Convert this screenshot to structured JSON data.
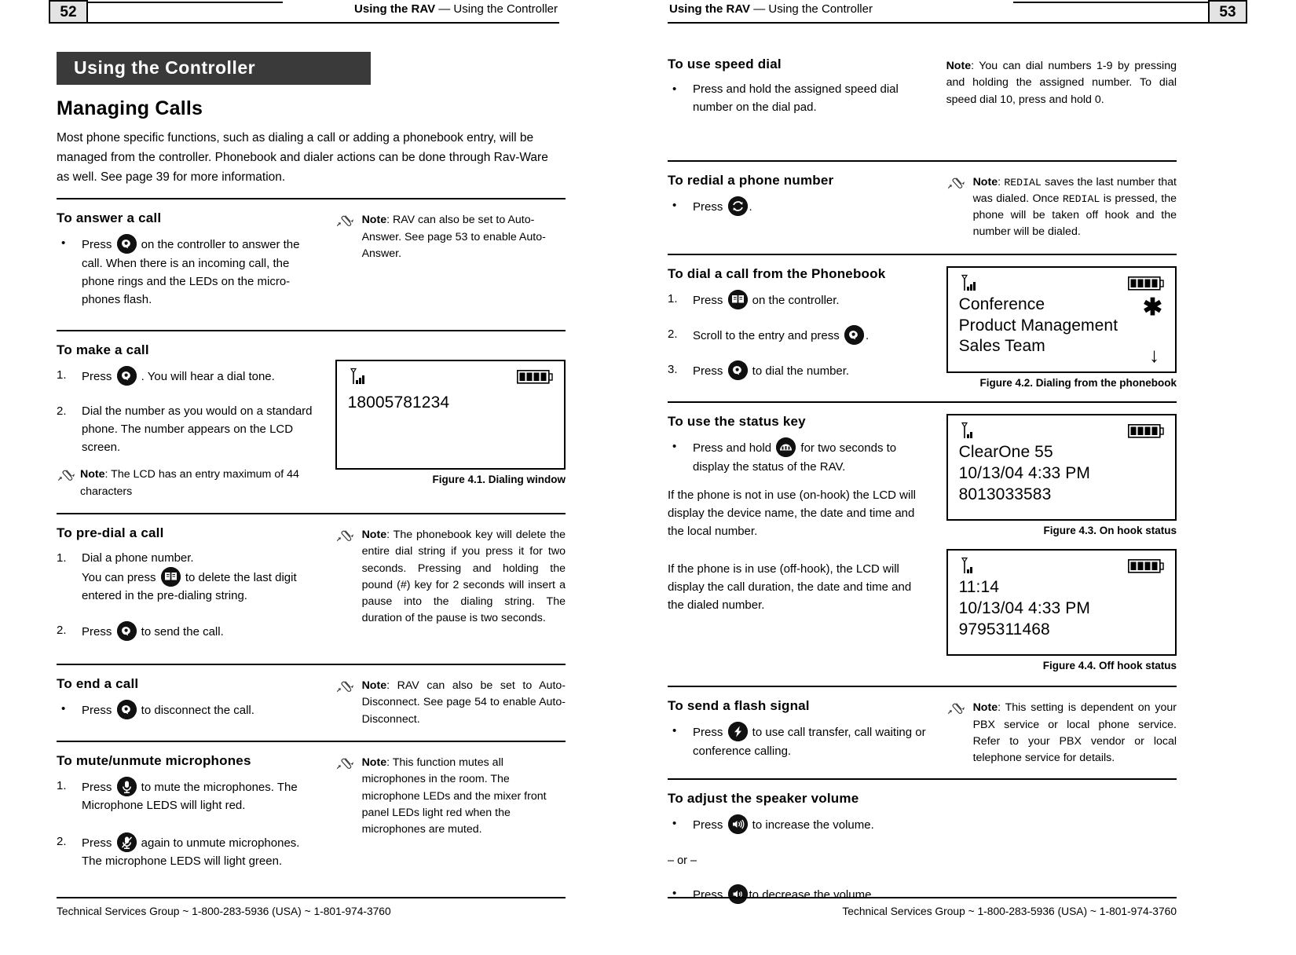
{
  "left_page": {
    "page_number": "52",
    "running_title_bold": "Using the RAV",
    "running_title_rest": "— Using the Controller",
    "banner": "Using the Controller",
    "chapter_heading": "Managing Calls",
    "intro": "Most phone specific functions, such as dialing a call or adding a phonebook entry, will be managed from the controller. Phonebook and dialer actions can be done through Rav-Ware as well. See page 39 for more information.",
    "sections": [
      {
        "heading": "To answer a call",
        "steps": [
          "Press  on the controller to answer the call. When there is an incoming call, the phone rings and the LEDs on the microphones flash."
        ],
        "note_label": "Note",
        "note_text": ": RAV can also be set to Auto-Answer. See page 53 to enable Auto-Answer."
      },
      {
        "heading": "To make a call",
        "step1": "Press  . You will hear a dial tone.",
        "step2": "Dial the number as you would on a standard phone. The number appears on the LCD screen.",
        "note_label": "Note",
        "note_text": ": The LCD has an entry maximum of 44 characters"
      },
      {
        "heading": "To pre-dial a call",
        "step1": "Dial a phone number.",
        "step1b_pre": "You can press ",
        "step1b_post": " to delete the last digit entered in the pre-dialing string.",
        "step2_pre": "Press ",
        "step2_post": " to send the call.",
        "note_label": "Note",
        "note_text": ":  The phonebook key will delete the entire dial string if you press it for two seconds. Pressing and holding the pound (#) key for 2 seconds will insert a pause into the dialing string. The duration of the pause is two seconds."
      },
      {
        "heading": "To end a call",
        "step_pre": "Press ",
        "step_post": " to disconnect the call.",
        "note_label": "Note",
        "note_text": ": RAV can also be set to Auto-Disconnect. See page 54 to enable Auto-Disconnect."
      },
      {
        "heading": "To mute/unmute microphones",
        "step1_pre": "Press ",
        "step1_post": " to mute the microphones. The Microphone LEDS will light red.",
        "step2_pre": "Press ",
        "step2_post": " again to unmute microphones. The microphone LEDS will light green.",
        "note_label": "Note",
        "note_text": ": This function mutes all microphones in the room. The microphone LEDs and the mixer front panel LEDs light red when the microphones are muted."
      }
    ],
    "figure_41": {
      "lcd_line1": "18005781234",
      "caption": "Figure 4.1. Dialing window"
    },
    "footer": "Technical Services Group ~ 1-800-283-5936 (USA) ~ 1-801-974-3760"
  },
  "right_page": {
    "page_number": "53",
    "running_title_bold": "Using the RAV",
    "running_title_rest": "— Using the Controller",
    "sections": [
      {
        "heading": "To use speed dial",
        "step": "Press and hold the assigned speed dial number on the dial pad.",
        "note_label": "Note",
        "note_text": ": You can dial numbers 1-9 by pressing and holding the assigned number. To dial speed dial 10, press and hold 0."
      },
      {
        "heading": "To redial a phone number",
        "step_pre": "Press ",
        "step_post": ".",
        "note_label": "Note",
        "note_text_1": ": ",
        "note_mono_1": "REDIAL",
        "note_text_2": " saves the last number that was dialed. Once ",
        "note_mono_2": "REDIAL",
        "note_text_3": " is pressed, the phone will be taken off hook and the number will be dialed."
      },
      {
        "heading": "To dial a call from the Phonebook",
        "step1_pre": "Press ",
        "step1_post": " on the controller.",
        "step2_pre": "Scroll to the entry and press ",
        "step2_post": ".",
        "step3_pre": "Press ",
        "step3_post": " to dial the number."
      },
      {
        "heading": "To use the status key",
        "step_pre": "Press and hold ",
        "step_post": " for two seconds to display the status of the RAV.",
        "para1": "If the phone is not in use (on-hook) the LCD will display the device name, the date and time and the local number.",
        "para2": "If the phone is in use (off-hook), the LCD will display the call duration, the date and time and the dialed number."
      },
      {
        "heading": "To send a flash signal",
        "step_pre": "Press ",
        "step_post": " to use call transfer, call waiting or conference calling.",
        "note_label": "Note",
        "note_text": ": This setting is dependent on your PBX service or local phone service. Refer to your PBX vendor or local telephone service for details."
      },
      {
        "heading": "To adjust the speaker volume",
        "step1_pre": "Press ",
        "step1_post": " to increase the volume.",
        "or_separator": "– or –",
        "step2_pre": "Press ",
        "step2_post": "to decrease the volume."
      }
    ],
    "figure_42": {
      "lcd_line1": "Conference",
      "lcd_line2": "Product Management",
      "lcd_line3": "Sales Team",
      "star": "✱",
      "arrow": "↓",
      "caption": "Figure 4.2. Dialing from the phonebook"
    },
    "figure_43": {
      "lcd_line1": "ClearOne 55",
      "lcd_line2": "10/13/04  4:33 PM",
      "lcd_line3": "8013033583",
      "caption": "Figure 4.3. On hook status"
    },
    "figure_44": {
      "lcd_line1": "11:14",
      "lcd_line2": "10/13/04  4:33 PM",
      "lcd_line3": "9795311468",
      "caption": "Figure 4.4. Off hook status"
    },
    "footer": "Technical Services Group ~ 1-800-283-5936 (USA) ~ 1-801-974-3760"
  },
  "markers": {
    "bullet": "•",
    "n1": "1.",
    "n2": "2.",
    "n3": "3."
  },
  "colors": {
    "banner_bg": "#3a3a3a",
    "pagenum_bg": "#e3e3e3",
    "rule": "#000000",
    "key_bg": "#111111"
  }
}
